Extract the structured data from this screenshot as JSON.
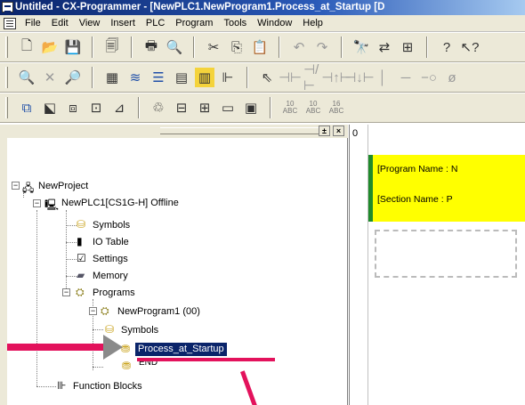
{
  "window": {
    "title": "Untitled - CX-Programmer - [NewPLC1.NewProgram1.Process_at_Startup [D"
  },
  "menubar": {
    "items": [
      "File",
      "Edit",
      "View",
      "Insert",
      "PLC",
      "Program",
      "Tools",
      "Window",
      "Help"
    ]
  },
  "toolbars": {
    "row1": [
      "new-icon",
      "open-icon",
      "save-icon",
      "print-preview-icon",
      "print-icon",
      "print-preview-2-icon",
      "cut-icon",
      "copy-icon",
      "paste-icon",
      "undo-icon",
      "redo-icon",
      "find-icon",
      "replace-icon",
      "cross-ref-icon",
      "help-icon",
      "whats-this-icon"
    ],
    "row2": [
      "zoom-in-icon",
      "zoom-out-icon",
      "zoom-icon",
      "grid-icon",
      "comment-icon",
      "list-icon",
      "monitor-icon",
      "ladder-icon",
      "tree-icon",
      "select-icon",
      "no-contact-icon",
      "nc-contact-icon",
      "rising-contact-icon",
      "falling-contact-icon",
      "vertical-line-icon",
      "horizontal-line-icon",
      "coil-icon",
      "nc-coil-icon"
    ],
    "row3": [
      "section-icon",
      "jump-icon",
      "window-icon",
      "rung-icon",
      "symbol-icon",
      "online-icon",
      "step-icon",
      "io-icon",
      "memory-icon",
      "table-icon"
    ],
    "row3_nums": [
      [
        "10",
        "ABC"
      ],
      [
        "10",
        "ABC"
      ],
      [
        "16",
        "ABC"
      ]
    ]
  },
  "tree": {
    "project": "NewProject",
    "plc": "NewPLC1[CS1G-H] Offline",
    "plc_children": [
      "Symbols",
      "IO Table",
      "Settings",
      "Memory",
      "Programs"
    ],
    "program": "NewProgram1 (00)",
    "program_children": [
      "Symbols",
      "Process_at_Startup",
      "END"
    ],
    "function_blocks": "Function Blocks"
  },
  "ladder": {
    "rung_number": "0",
    "comment_lines": [
      "[Program Name : N",
      "[Section Name : P"
    ]
  },
  "colors": {
    "title_bar": "#0a246a",
    "selection": "#0a246a",
    "comment_background": "#ffff00",
    "rung_marker": "#1f8a2b",
    "annotation": "#e3125c"
  }
}
